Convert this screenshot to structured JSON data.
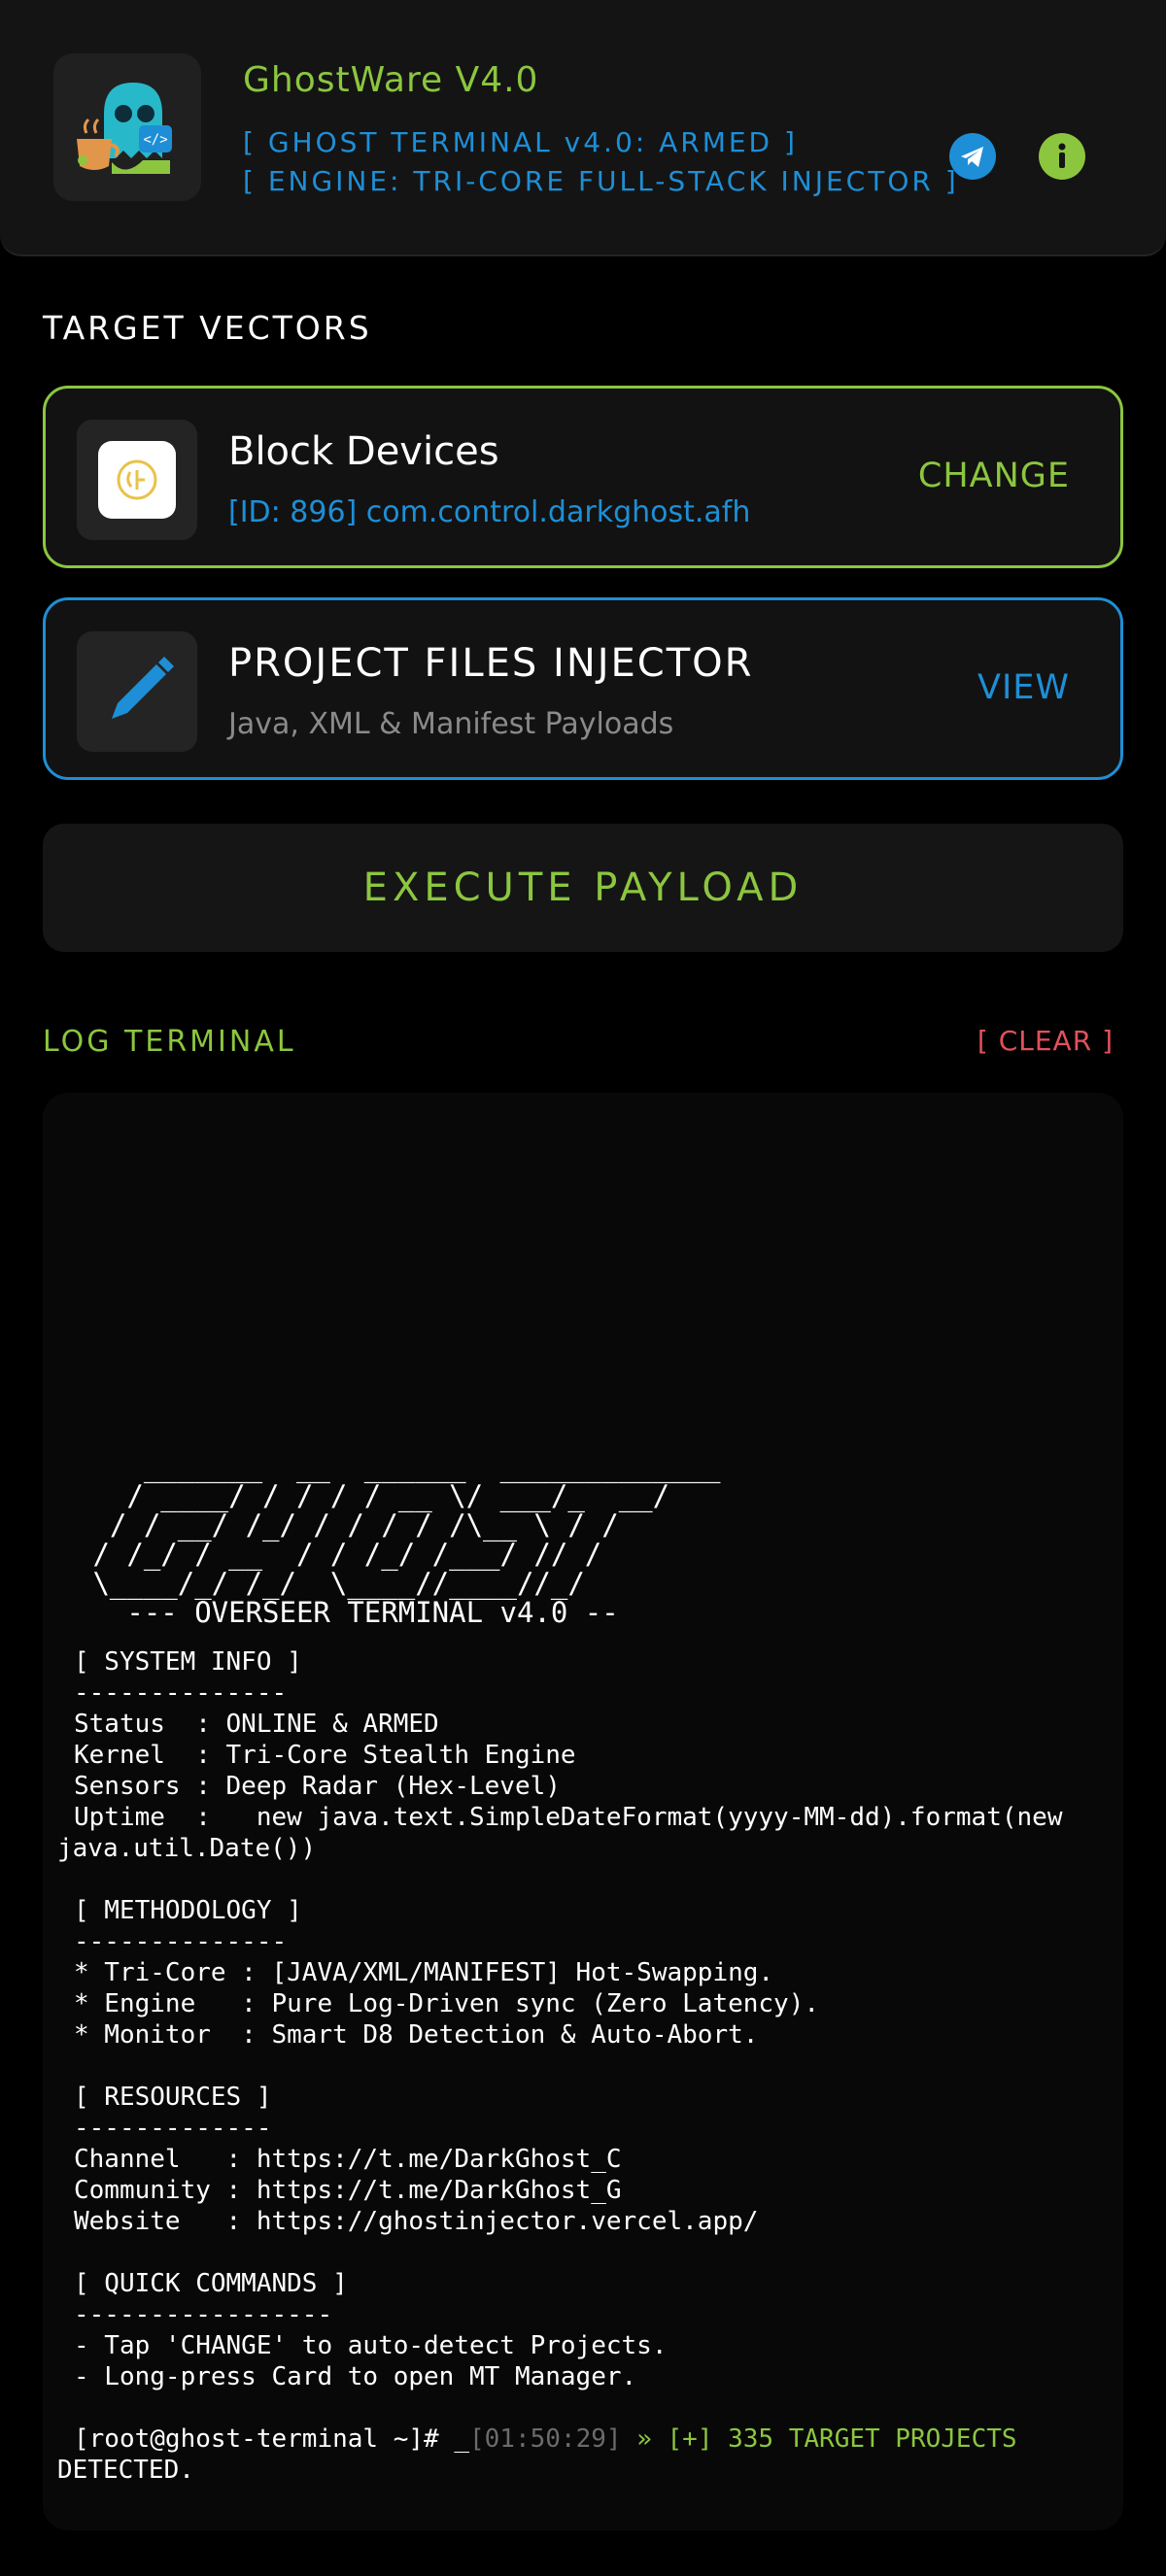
{
  "header": {
    "app_title": "GhostWare V4.0",
    "line1": "[ GHOST TERMINAL v4.0: ARMED ]",
    "line2": "[ ENGINE: TRI-CORE FULL-STACK INJECTOR ]",
    "telegram_icon": "telegram-icon",
    "info_icon": "info-icon",
    "colors": {
      "accent_green": "#8cc63f",
      "accent_blue": "#1e8fd6",
      "danger": "#e0525a"
    }
  },
  "target_vectors": {
    "title": "TARGET VECTORS",
    "app_card": {
      "name": "Block Devices",
      "detail": "[ID: 896] com.control.darkghost.afh",
      "action": "CHANGE"
    },
    "files_card": {
      "name": "PROJECT FILES INJECTOR",
      "detail": "Java, XML & Manifest Payloads",
      "action": "VIEW"
    }
  },
  "execute_label": "EXECUTE PAYLOAD",
  "log": {
    "title": "LOG TERMINAL",
    "clear_label": "[ CLEAR ]",
    "ascii_art": "    _______  __  ______  _____________\n   / ____/ / / / / __ \\/ ___/_  __/\n  / / __/ /_/ / / / / /\\__ \\ / /\n / /_/ / __  / / /_/ /___/ // /\n \\____/_/ /_/  \\____//____//_/\n   --- OVERSEER TERMINAL v4.0 --",
    "lines": {
      "sys_head": "[ SYSTEM INFO ]",
      "sys_rule": "--------------",
      "status": "Status  : ONLINE & ARMED",
      "kernel": "Kernel  : Tri-Core Stealth Engine",
      "sensors": "Sensors : Deep Radar (Hex-Level)",
      "uptime_1": "Uptime  :   new java.text.SimpleDateFormat(yyyy-MM-dd).format(new",
      "uptime_2": "java.util.Date())",
      "meth_head": "[ METHODOLOGY ]",
      "meth_rule": "--------------",
      "meth_1": "* Tri-Core : [JAVA/XML/MANIFEST] Hot-Swapping.",
      "meth_2": "* Engine   : Pure Log-Driven sync (Zero Latency).",
      "meth_3": "* Monitor  : Smart D8 Detection & Auto-Abort.",
      "res_head": "[ RESOURCES ]",
      "res_rule": "-------------",
      "channel": "Channel   : https://t.me/DarkGhost_C",
      "community": "Community : https://t.me/DarkGhost_G",
      "website": "Website   : https://ghostinjector.vercel.app/",
      "qc_head": "[ QUICK COMMANDS ]",
      "qc_rule": "-----------------",
      "qc_1": "- Tap 'CHANGE' to auto-detect Projects.",
      "qc_2": "- Long-press Card to open MT Manager.",
      "prompt": "[root@ghost-terminal ~]# _",
      "timestamp": "[01:50:29]",
      "result_1": " » [+] 335 TARGET PROJECTS",
      "result_2": "DETECTED."
    }
  }
}
